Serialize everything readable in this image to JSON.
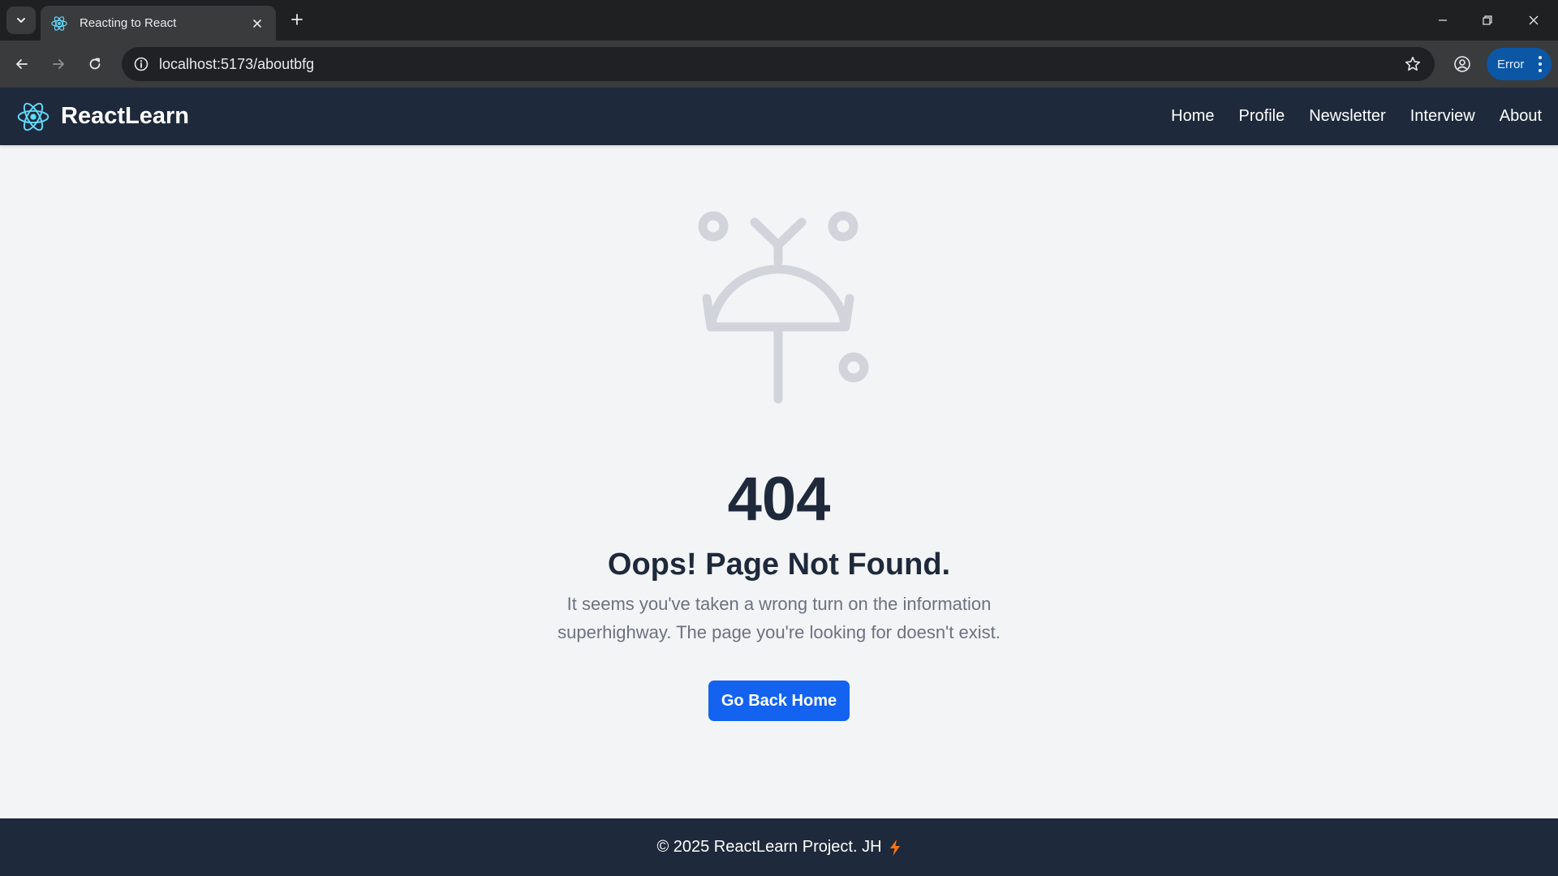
{
  "browser": {
    "tab": {
      "title": "Reacting to React"
    },
    "address_bar": {
      "url": "localhost:5173/aboutbfg"
    },
    "error_chip": {
      "label": "Error"
    }
  },
  "site": {
    "brand": {
      "name": "ReactLearn"
    },
    "nav": [
      {
        "label": "Home"
      },
      {
        "label": "Profile"
      },
      {
        "label": "Newsletter"
      },
      {
        "label": "Interview"
      },
      {
        "label": "About"
      }
    ]
  },
  "not_found": {
    "code": "404",
    "headline": "Oops! Page Not Found.",
    "description": "It seems you've taken a wrong turn on the information superhighway. The page you're looking for doesn't exist.",
    "button_label": "Go Back Home"
  },
  "footer": {
    "text": "© 2025 ReactLearn Project. JH"
  },
  "colors": {
    "header_bg": "#1e293b",
    "page_bg": "#f3f4f6",
    "button_bg": "#1363f0",
    "illustration": "#d1d5db",
    "react_logo": "#61dafb",
    "bolt": "#f97316"
  },
  "icons": {
    "tab_favicon": "react-icon",
    "brand_logo": "react-icon",
    "illustration": "broken-satellite-icon",
    "footer": "lightning-bolt-icon"
  }
}
